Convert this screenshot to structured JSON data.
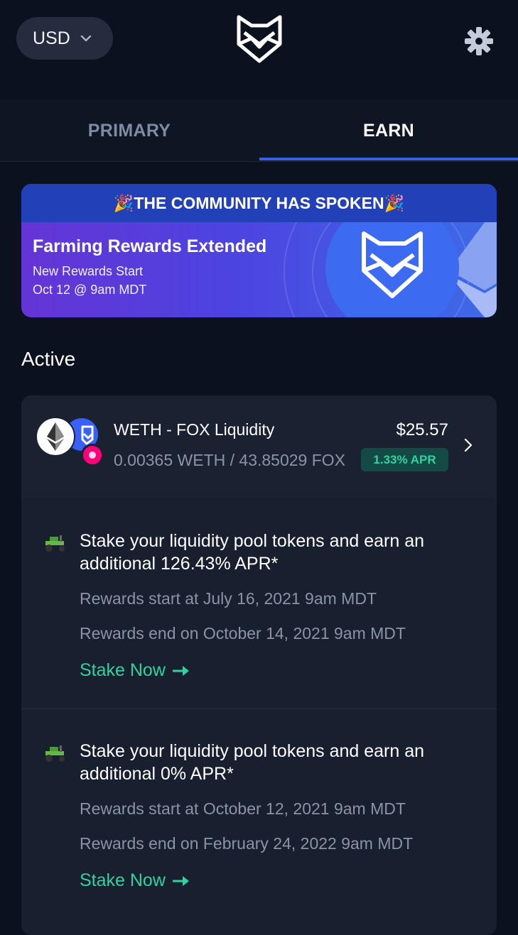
{
  "header": {
    "currency": "USD",
    "logo_icon": "fox-logo-icon",
    "settings_icon": "gear-icon"
  },
  "tabs": [
    {
      "label": "PRIMARY",
      "active": false
    },
    {
      "label": "EARN",
      "active": true
    }
  ],
  "banner": {
    "headline": "🎉THE COMMUNITY HAS SPOKEN🎉",
    "title": "Farming Rewards Extended",
    "subtitle_line1": "New Rewards Start",
    "subtitle_line2": "Oct 12 @ 9am MDT"
  },
  "section": {
    "title": "Active"
  },
  "pool": {
    "name": "WETH - FOX Liquidity",
    "balance": "0.00365 WETH / 43.85029 FOX",
    "value": "$25.57",
    "apr": "1.33% APR",
    "tokens": [
      "eth-icon",
      "fox-icon",
      "uniswap-icon"
    ]
  },
  "rewards": [
    {
      "title": "Stake your liquidity pool tokens and earn an additional 126.43% APR*",
      "start": "Rewards start at July 16, 2021 9am MDT",
      "end": "Rewards end on October 14, 2021 9am MDT",
      "cta": "Stake Now"
    },
    {
      "title": "Stake your liquidity pool tokens and earn an additional 0% APR*",
      "start": "Rewards start at October 12, 2021 9am MDT",
      "end": "Rewards end on February 24, 2022 9am MDT",
      "cta": "Stake Now"
    }
  ],
  "colors": {
    "background": "#0b111e",
    "accent": "#3860e6",
    "positive": "#2fd39e",
    "muted_text": "#8b93a7"
  }
}
